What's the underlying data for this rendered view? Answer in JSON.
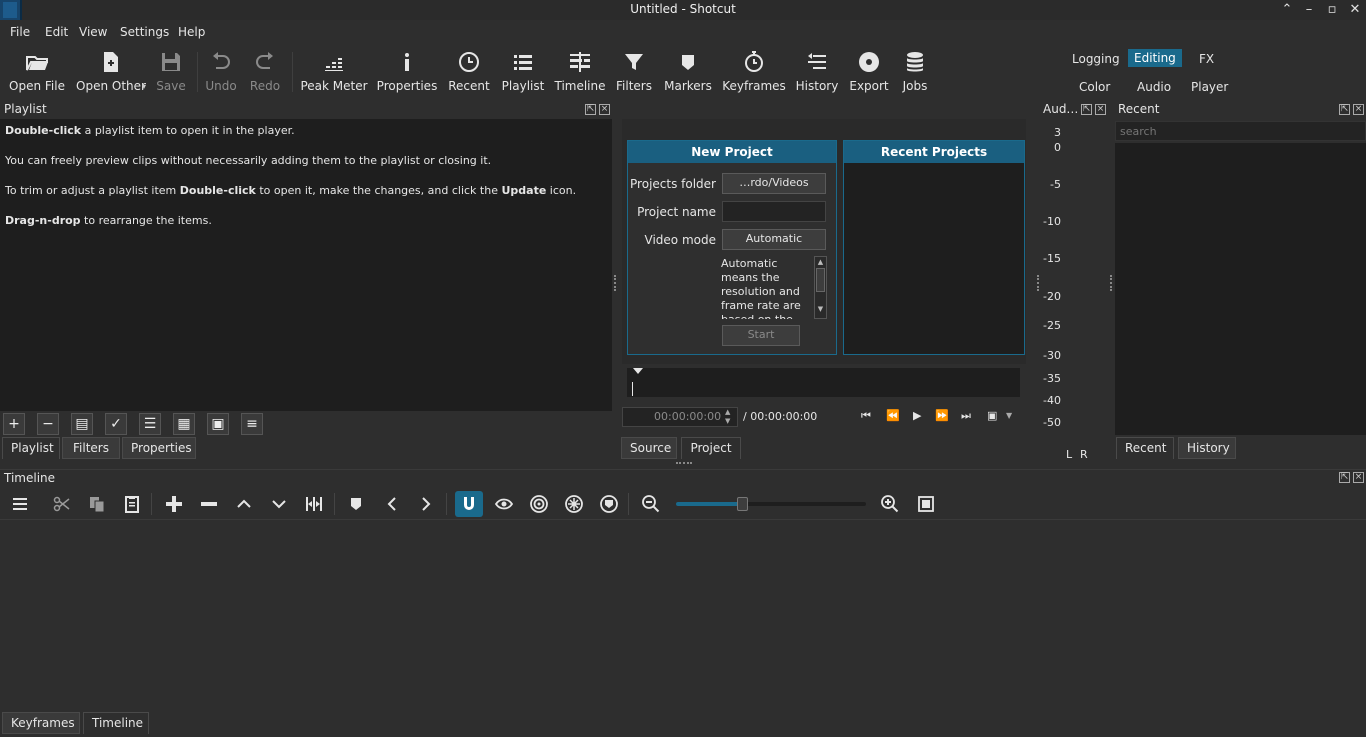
{
  "window": {
    "title": "Untitled - Shotcut"
  },
  "menu": {
    "file": "File",
    "edit": "Edit",
    "view": "View",
    "settings": "Settings",
    "help": "Help"
  },
  "toolbar": {
    "open_file": "Open File",
    "open_other": "Open Other",
    "save": "Save",
    "undo": "Undo",
    "redo": "Redo",
    "peak_meter": "Peak Meter",
    "properties": "Properties",
    "recent": "Recent",
    "playlist": "Playlist",
    "timeline": "Timeline",
    "filters": "Filters",
    "markers": "Markers",
    "keyframes": "Keyframes",
    "history": "History",
    "export": "Export",
    "jobs": "Jobs"
  },
  "workspaces": {
    "logging": "Logging",
    "editing": "Editing",
    "fx": "FX",
    "color": "Color",
    "audio": "Audio",
    "player": "Player"
  },
  "playlist": {
    "title": "Playlist",
    "line1_bold": "Double-click",
    "line1_rest": " a playlist item to open it in the player.",
    "line2": "You can freely preview clips without necessarily adding them to the playlist or closing it.",
    "line3_a": "To trim or adjust a playlist item ",
    "line3_bold1": "Double-click",
    "line3_b": " to open it, make the changes, and click the ",
    "line3_bold2": "Update",
    "line3_c": " icon.",
    "line4_bold": "Drag-n-drop",
    "line4_rest": " to rearrange the items.",
    "tabs": {
      "playlist": "Playlist",
      "filters": "Filters",
      "properties": "Properties"
    }
  },
  "new_project": {
    "title": "New Project",
    "projects_folder_label": "Projects folder",
    "projects_folder_value": "…rdo/Videos",
    "project_name_label": "Project name",
    "project_name_value": "",
    "video_mode_label": "Video mode",
    "video_mode_value": "Automatic",
    "description": "Automatic means the resolution and frame rate are based on the",
    "start": "Start"
  },
  "recent_projects": {
    "title": "Recent Projects"
  },
  "player": {
    "timecode": "00:00:00:00",
    "duration": "/ 00:00:00:00",
    "tabs": {
      "source": "Source",
      "project": "Project"
    }
  },
  "audio_meter": {
    "title": "Aud…",
    "scale": [
      "3",
      "0",
      "-5",
      "-10",
      "-15",
      "-20",
      "-25",
      "-30",
      "-35",
      "-40",
      "-50"
    ],
    "channels": {
      "left": "L",
      "right": "R"
    }
  },
  "recent_panel": {
    "title": "Recent",
    "search_placeholder": "search",
    "tabs": {
      "recent": "Recent",
      "history": "History"
    }
  },
  "timeline": {
    "title": "Timeline",
    "zoom_level": 0.34
  },
  "bottom_tabs": {
    "keyframes": "Keyframes",
    "timeline": "Timeline"
  },
  "colors": {
    "accent": "#1a6a8c",
    "panel_bg": "#1e1e1e",
    "window_bg": "#2e2e2e"
  }
}
